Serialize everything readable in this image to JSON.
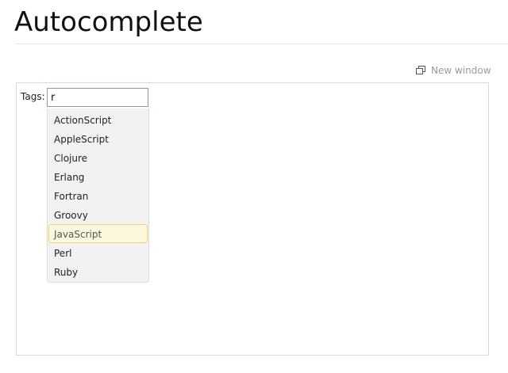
{
  "page": {
    "title": "Autocomplete"
  },
  "toolbar": {
    "new_window_label": "New window",
    "new_window_icon": "new-window-icon"
  },
  "form": {
    "tags_label": "Tags:",
    "tags_value": "r"
  },
  "autocomplete": {
    "items": [
      {
        "label": "ActionScript",
        "active": false
      },
      {
        "label": "AppleScript",
        "active": false
      },
      {
        "label": "Clojure",
        "active": false
      },
      {
        "label": "Erlang",
        "active": false
      },
      {
        "label": "Fortran",
        "active": false
      },
      {
        "label": "Groovy",
        "active": false
      },
      {
        "label": "JavaScript",
        "active": true
      },
      {
        "label": "Perl",
        "active": false
      },
      {
        "label": "Ruby",
        "active": false
      }
    ]
  },
  "colors": {
    "active_item_background": "#fbf8dd",
    "active_item_border": "#f0d36a",
    "menu_background": "#f2f2f2",
    "input_border": "#7f9db9"
  }
}
